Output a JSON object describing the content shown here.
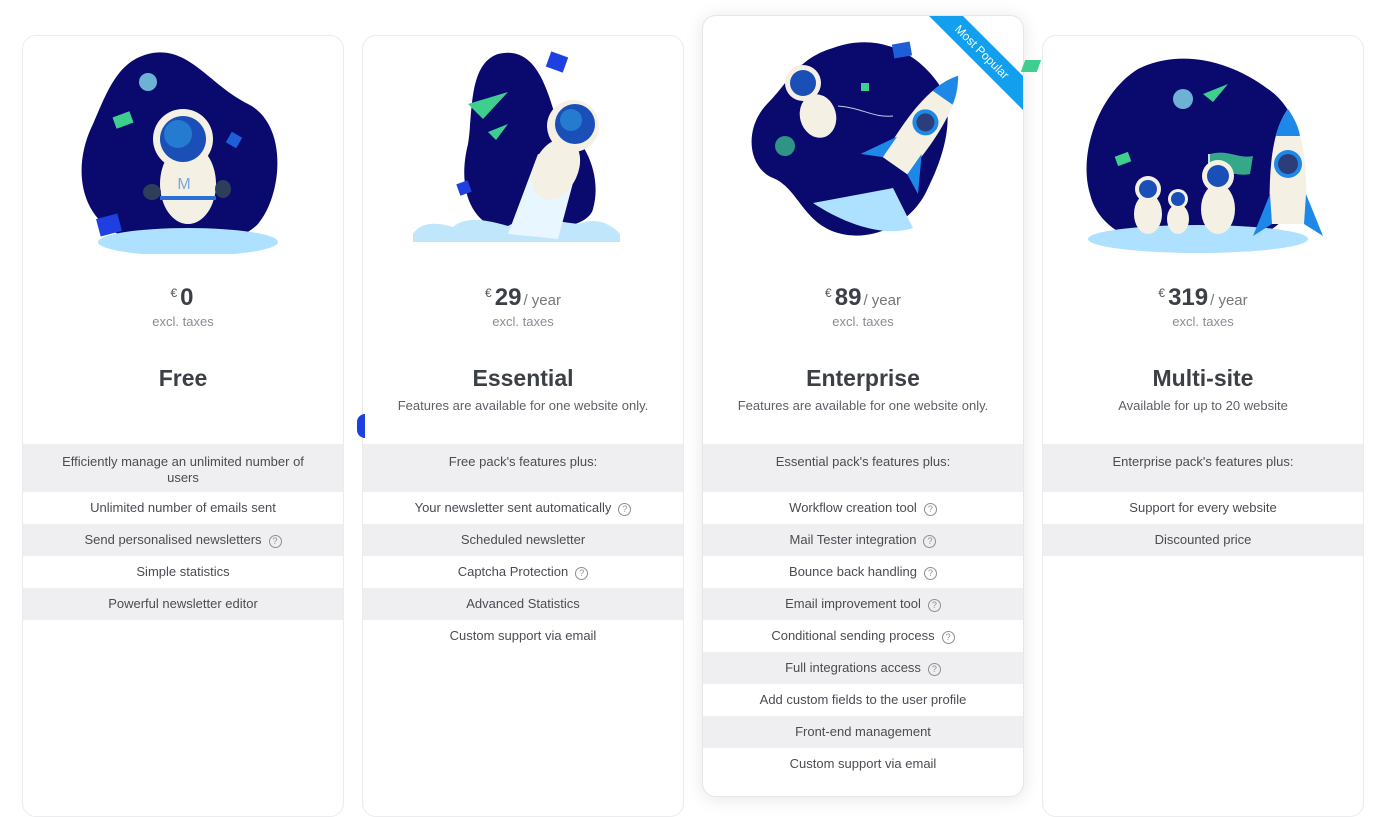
{
  "plans": [
    {
      "id": "free",
      "currency": "€",
      "amount": "0",
      "period": "",
      "tax_note": "excl. taxes",
      "name": "Free",
      "description": "",
      "features_header": "Efficiently manage an unlimited number of users",
      "features": [
        {
          "label": "Unlimited number of emails sent",
          "help": false
        },
        {
          "label": "Send personalised newsletters",
          "help": true
        },
        {
          "label": "Simple statistics",
          "help": false
        },
        {
          "label": "Powerful newsletter editor",
          "help": false
        }
      ]
    },
    {
      "id": "essential",
      "currency": "€",
      "amount": "29",
      "period": "/  year",
      "tax_note": "excl. taxes",
      "name": "Essential",
      "description": "Features are available for one website only.",
      "features_header": "Free pack's features plus:",
      "features": [
        {
          "label": "Your newsletter sent automatically",
          "help": true
        },
        {
          "label": "Scheduled newsletter",
          "help": false
        },
        {
          "label": "Captcha Protection",
          "help": true
        },
        {
          "label": "Advanced Statistics",
          "help": false
        },
        {
          "label": "Custom support via email",
          "help": false
        }
      ]
    },
    {
      "id": "enterprise",
      "currency": "€",
      "amount": "89",
      "period": "/  year",
      "tax_note": "excl. taxes",
      "name": "Enterprise",
      "description": "Features are available for one website only.",
      "badge": "Most Popular",
      "features_header": "Essential pack's features plus:",
      "features": [
        {
          "label": "Workflow creation tool",
          "help": true
        },
        {
          "label": "Mail Tester integration",
          "help": true
        },
        {
          "label": "Bounce back handling",
          "help": true
        },
        {
          "label": "Email improvement tool",
          "help": true
        },
        {
          "label": "Conditional sending process",
          "help": true
        },
        {
          "label": "Full integrations access",
          "help": true
        },
        {
          "label": "Add custom fields to the user profile",
          "help": false
        },
        {
          "label": "Front-end management",
          "help": false
        },
        {
          "label": "Custom support via email",
          "help": false
        }
      ]
    },
    {
      "id": "multisite",
      "currency": "€",
      "amount": "319",
      "period": "/  year",
      "tax_note": "excl. taxes",
      "name": "Multi-site",
      "description": "Available for up to 20 website",
      "features_header": "Enterprise pack's features plus:",
      "features": [
        {
          "label": "Support for every website",
          "help": false
        },
        {
          "label": "Discounted price",
          "help": false
        }
      ]
    }
  ],
  "icons": {
    "help": "?",
    "illustrations": [
      "astronaut-walking-illustration",
      "astronaut-jetpack-illustration",
      "astronaut-rocket-illustration",
      "astronauts-flag-rocket-illustration"
    ]
  },
  "colors": {
    "space_navy": "#0a0a6e",
    "ribbon_blue": "#12a0ee",
    "row_alt": "#efeff1",
    "accent_green": "#3ecf8e",
    "moon_light": "#aee0ff"
  }
}
